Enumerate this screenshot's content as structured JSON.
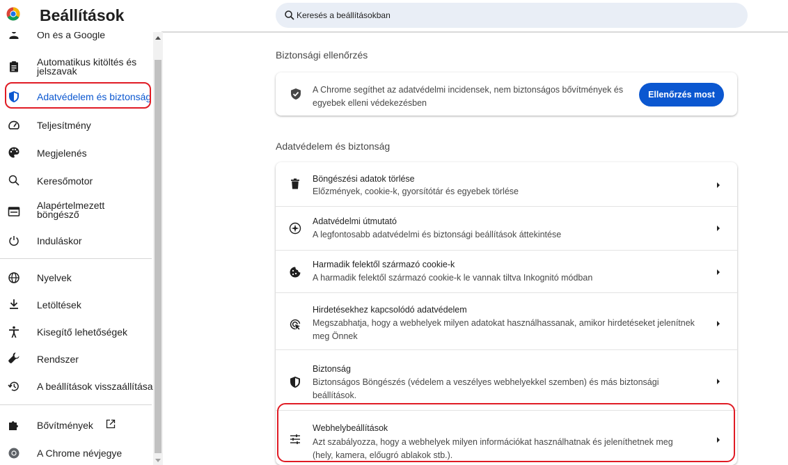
{
  "header": {
    "title": "Beállítások",
    "search_placeholder": "Keresés a beállításokban"
  },
  "sidebar": {
    "items": [
      {
        "label": "Ön és a Google",
        "icon": "person-icon"
      },
      {
        "label": "Automatikus kitöltés és jelszavak",
        "icon": "clipboard-icon"
      },
      {
        "label": "Adatvédelem és biztonság",
        "icon": "shield-icon",
        "active": true
      },
      {
        "label": "Teljesítmény",
        "icon": "gauge-icon"
      },
      {
        "label": "Megjelenés",
        "icon": "palette-icon"
      },
      {
        "label": "Keresőmotor",
        "icon": "search-icon"
      },
      {
        "label": "Alapértelmezett böngésző",
        "icon": "browser-window-icon"
      },
      {
        "label": "Induláskor",
        "icon": "power-icon"
      },
      {
        "label": "Nyelvek",
        "icon": "globe-icon"
      },
      {
        "label": "Letöltések",
        "icon": "download-icon"
      },
      {
        "label": "Kisegítő lehetőségek",
        "icon": "accessibility-icon"
      },
      {
        "label": "Rendszer",
        "icon": "wrench-icon"
      },
      {
        "label": "A beállítások visszaállítása",
        "icon": "restore-icon"
      },
      {
        "label": "Bővítmények",
        "icon": "puzzle-icon"
      },
      {
        "label": "A Chrome névjegye",
        "icon": "chrome-icon"
      }
    ]
  },
  "safety_check": {
    "section_title": "Biztonsági ellenőrzés",
    "text": "A Chrome segíthet az adatvédelmi incidensek, nem biztonságos bővítmények és egyebek elleni védekezésben",
    "button_label": "Ellenőrzés most",
    "icon": "shield-check-icon"
  },
  "privacy": {
    "section_title": "Adatvédelem és biztonság",
    "rows": [
      {
        "title": "Böngészési adatok törlése",
        "description": "Előzmények, cookie-k, gyorsítótár és egyebek törlése",
        "icon": "trash-icon"
      },
      {
        "title": "Adatvédelmi útmutató",
        "description": "A legfontosabb adatvédelmi és biztonsági beállítások áttekintése",
        "icon": "compass-icon"
      },
      {
        "title": "Harmadik felektől származó cookie-k",
        "description": "A harmadik felektől származó cookie-k le vannak tiltva Inkognitó módban",
        "icon": "cookie-icon"
      },
      {
        "title": "Hirdetésekhez kapcsolódó adatvédelem",
        "description": "Megszabhatja, hogy a webhelyek milyen adatokat használhassanak, amikor hirdetéseket jelenítnek meg Önnek",
        "icon": "ad-privacy-icon"
      },
      {
        "title": "Biztonság",
        "description": "Biztonságos Böngészés (védelem a veszélyes webhelyekkel szemben) és más biztonsági beállítások.",
        "icon": "shield-icon"
      },
      {
        "title": "Webhelybeállítások",
        "description": "Azt szabályozza, hogy a webhelyek milyen információkat használhatnak és jeleníthetnek meg (hely, kamera, előugró ablakok stb.).",
        "icon": "tune-icon"
      }
    ]
  },
  "colors": {
    "accent": "#0b57d0",
    "annotation_ring": "#e01b24"
  }
}
